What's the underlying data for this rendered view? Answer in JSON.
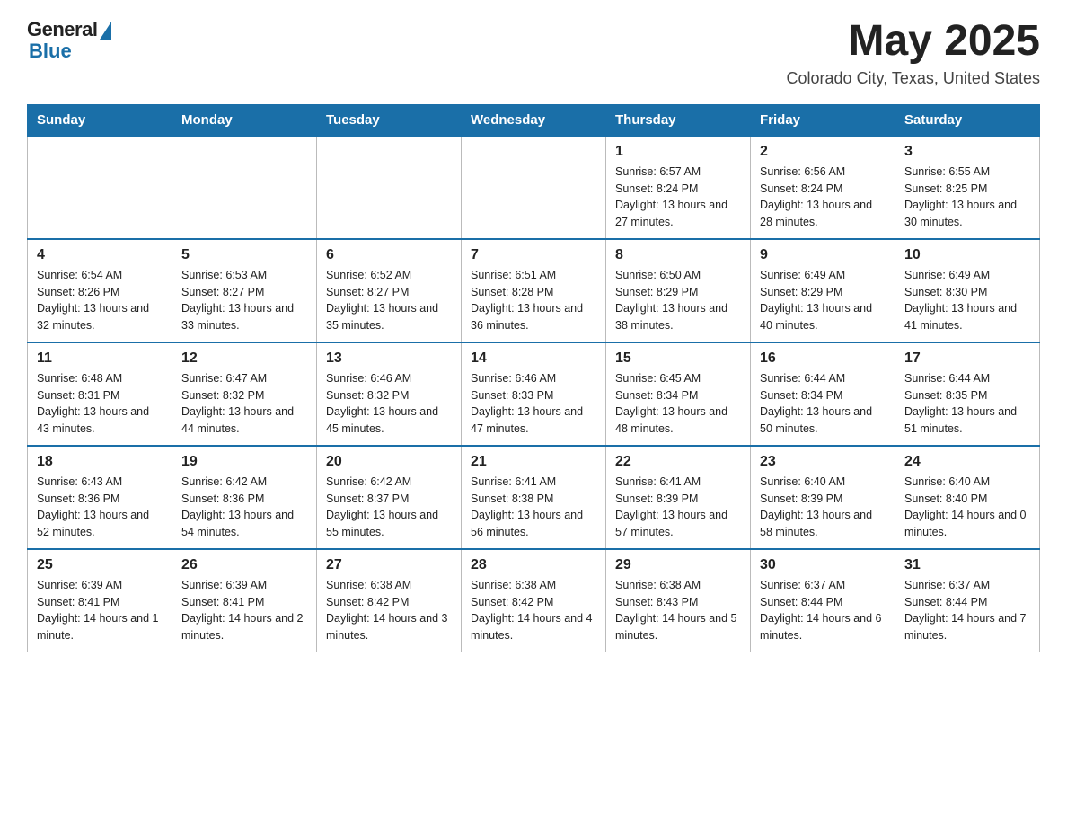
{
  "header": {
    "logo_general": "General",
    "logo_blue": "Blue",
    "month_title": "May 2025",
    "location": "Colorado City, Texas, United States"
  },
  "days_of_week": [
    "Sunday",
    "Monday",
    "Tuesday",
    "Wednesday",
    "Thursday",
    "Friday",
    "Saturday"
  ],
  "weeks": [
    [
      {
        "day": "",
        "info": ""
      },
      {
        "day": "",
        "info": ""
      },
      {
        "day": "",
        "info": ""
      },
      {
        "day": "",
        "info": ""
      },
      {
        "day": "1",
        "info": "Sunrise: 6:57 AM\nSunset: 8:24 PM\nDaylight: 13 hours and 27 minutes."
      },
      {
        "day": "2",
        "info": "Sunrise: 6:56 AM\nSunset: 8:24 PM\nDaylight: 13 hours and 28 minutes."
      },
      {
        "day": "3",
        "info": "Sunrise: 6:55 AM\nSunset: 8:25 PM\nDaylight: 13 hours and 30 minutes."
      }
    ],
    [
      {
        "day": "4",
        "info": "Sunrise: 6:54 AM\nSunset: 8:26 PM\nDaylight: 13 hours and 32 minutes."
      },
      {
        "day": "5",
        "info": "Sunrise: 6:53 AM\nSunset: 8:27 PM\nDaylight: 13 hours and 33 minutes."
      },
      {
        "day": "6",
        "info": "Sunrise: 6:52 AM\nSunset: 8:27 PM\nDaylight: 13 hours and 35 minutes."
      },
      {
        "day": "7",
        "info": "Sunrise: 6:51 AM\nSunset: 8:28 PM\nDaylight: 13 hours and 36 minutes."
      },
      {
        "day": "8",
        "info": "Sunrise: 6:50 AM\nSunset: 8:29 PM\nDaylight: 13 hours and 38 minutes."
      },
      {
        "day": "9",
        "info": "Sunrise: 6:49 AM\nSunset: 8:29 PM\nDaylight: 13 hours and 40 minutes."
      },
      {
        "day": "10",
        "info": "Sunrise: 6:49 AM\nSunset: 8:30 PM\nDaylight: 13 hours and 41 minutes."
      }
    ],
    [
      {
        "day": "11",
        "info": "Sunrise: 6:48 AM\nSunset: 8:31 PM\nDaylight: 13 hours and 43 minutes."
      },
      {
        "day": "12",
        "info": "Sunrise: 6:47 AM\nSunset: 8:32 PM\nDaylight: 13 hours and 44 minutes."
      },
      {
        "day": "13",
        "info": "Sunrise: 6:46 AM\nSunset: 8:32 PM\nDaylight: 13 hours and 45 minutes."
      },
      {
        "day": "14",
        "info": "Sunrise: 6:46 AM\nSunset: 8:33 PM\nDaylight: 13 hours and 47 minutes."
      },
      {
        "day": "15",
        "info": "Sunrise: 6:45 AM\nSunset: 8:34 PM\nDaylight: 13 hours and 48 minutes."
      },
      {
        "day": "16",
        "info": "Sunrise: 6:44 AM\nSunset: 8:34 PM\nDaylight: 13 hours and 50 minutes."
      },
      {
        "day": "17",
        "info": "Sunrise: 6:44 AM\nSunset: 8:35 PM\nDaylight: 13 hours and 51 minutes."
      }
    ],
    [
      {
        "day": "18",
        "info": "Sunrise: 6:43 AM\nSunset: 8:36 PM\nDaylight: 13 hours and 52 minutes."
      },
      {
        "day": "19",
        "info": "Sunrise: 6:42 AM\nSunset: 8:36 PM\nDaylight: 13 hours and 54 minutes."
      },
      {
        "day": "20",
        "info": "Sunrise: 6:42 AM\nSunset: 8:37 PM\nDaylight: 13 hours and 55 minutes."
      },
      {
        "day": "21",
        "info": "Sunrise: 6:41 AM\nSunset: 8:38 PM\nDaylight: 13 hours and 56 minutes."
      },
      {
        "day": "22",
        "info": "Sunrise: 6:41 AM\nSunset: 8:39 PM\nDaylight: 13 hours and 57 minutes."
      },
      {
        "day": "23",
        "info": "Sunrise: 6:40 AM\nSunset: 8:39 PM\nDaylight: 13 hours and 58 minutes."
      },
      {
        "day": "24",
        "info": "Sunrise: 6:40 AM\nSunset: 8:40 PM\nDaylight: 14 hours and 0 minutes."
      }
    ],
    [
      {
        "day": "25",
        "info": "Sunrise: 6:39 AM\nSunset: 8:41 PM\nDaylight: 14 hours and 1 minute."
      },
      {
        "day": "26",
        "info": "Sunrise: 6:39 AM\nSunset: 8:41 PM\nDaylight: 14 hours and 2 minutes."
      },
      {
        "day": "27",
        "info": "Sunrise: 6:38 AM\nSunset: 8:42 PM\nDaylight: 14 hours and 3 minutes."
      },
      {
        "day": "28",
        "info": "Sunrise: 6:38 AM\nSunset: 8:42 PM\nDaylight: 14 hours and 4 minutes."
      },
      {
        "day": "29",
        "info": "Sunrise: 6:38 AM\nSunset: 8:43 PM\nDaylight: 14 hours and 5 minutes."
      },
      {
        "day": "30",
        "info": "Sunrise: 6:37 AM\nSunset: 8:44 PM\nDaylight: 14 hours and 6 minutes."
      },
      {
        "day": "31",
        "info": "Sunrise: 6:37 AM\nSunset: 8:44 PM\nDaylight: 14 hours and 7 minutes."
      }
    ]
  ]
}
